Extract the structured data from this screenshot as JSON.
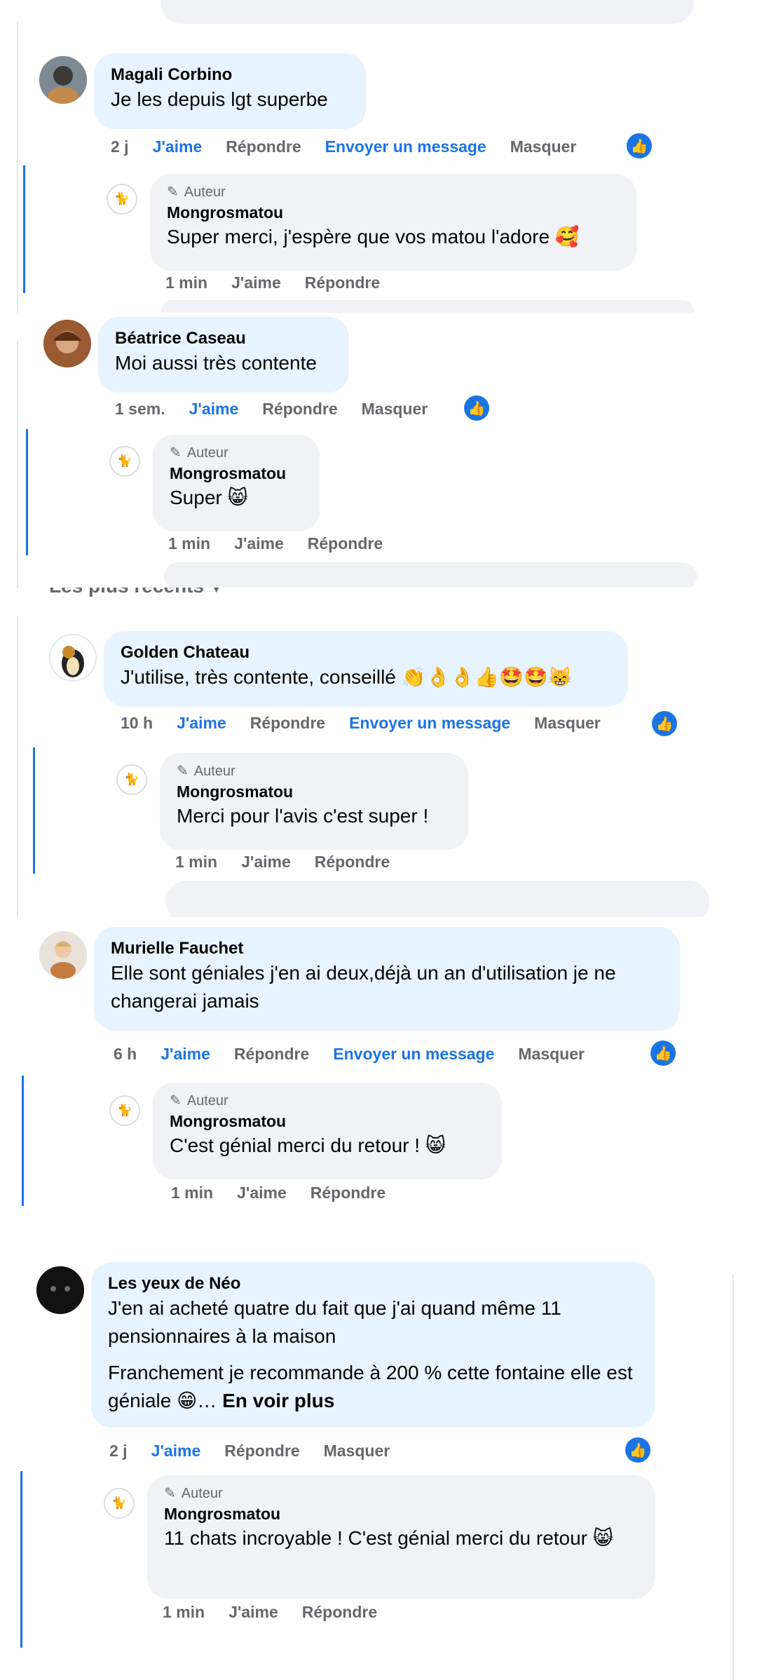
{
  "sort": {
    "label": "Les plus récents",
    "chevron_icon": "chevron-down-icon"
  },
  "icons": {
    "like": "thumbs-up-icon",
    "author": "pen-icon",
    "cat_avatar": "cat-icon"
  },
  "colors": {
    "accent": "#1b74e4",
    "bubble": "#e7f3ff",
    "reply_bubble": "#f0f2f5",
    "muted": "#65676b"
  },
  "comments": [
    {
      "name": "Magali Corbino",
      "text": "Je les depuis lgt superbe",
      "time": "2 j",
      "like": "J'aime",
      "reply": "Répondre",
      "message": "Envoyer un message",
      "hide": "Masquer",
      "answer": {
        "badge": "Auteur",
        "name": "Mongrosmatou",
        "text": "Super merci, j'espère que vos matou l'adore 🥰",
        "time": "1 min",
        "like": "J'aime",
        "reply": "Répondre"
      }
    },
    {
      "name": "Béatrice Caseau",
      "text": "Moi aussi très contente",
      "time": "1 sem.",
      "like": "J'aime",
      "reply": "Répondre",
      "hide": "Masquer",
      "answer": {
        "badge": "Auteur",
        "name": "Mongrosmatou",
        "text": "Super 😸",
        "time": "1 min",
        "like": "J'aime",
        "reply": "Répondre"
      }
    },
    {
      "name": "Golden Chateau",
      "text": "J'utilise, très contente, conseillé 👏👌👌👍🤩🤩😸",
      "time": "10 h",
      "like": "J'aime",
      "reply": "Répondre",
      "message": "Envoyer un message",
      "hide": "Masquer",
      "answer": {
        "badge": "Auteur",
        "name": "Mongrosmatou",
        "text": "Merci pour l'avis c'est super !",
        "time": "1 min",
        "like": "J'aime",
        "reply": "Répondre"
      }
    },
    {
      "name": "Murielle Fauchet",
      "text": "Elle sont géniales j'en ai deux,déjà un an d'utilisation je ne changerai jamais",
      "time": "6 h",
      "like": "J'aime",
      "reply": "Répondre",
      "message": "Envoyer un message",
      "hide": "Masquer",
      "answer": {
        "badge": "Auteur",
        "name": "Mongrosmatou",
        "text": "C'est génial merci du retour ! 😸",
        "time": "1 min",
        "like": "J'aime",
        "reply": "Répondre"
      }
    },
    {
      "name": "Les yeux de Néo",
      "text": "J'en ai acheté quatre du fait que j'ai quand même 11 pensionnaires à la maison",
      "text2": "Franchement je recommande à 200 % cette fontaine elle est géniale 😁…",
      "see_more": "En voir plus",
      "time": "2 j",
      "like": "J'aime",
      "reply": "Répondre",
      "hide": "Masquer",
      "answer": {
        "badge": "Auteur",
        "name": "Mongrosmatou",
        "text": "11 chats incroyable ! C'est génial merci du retour 😸",
        "time": "1 min",
        "like": "J'aime",
        "reply": "Répondre"
      }
    }
  ]
}
